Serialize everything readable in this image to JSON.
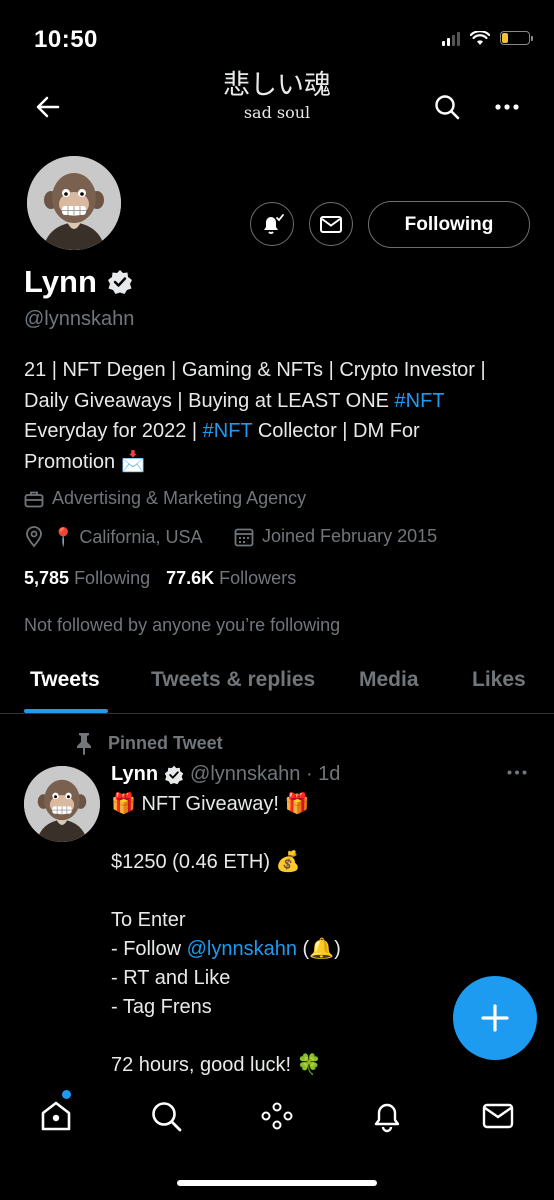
{
  "status_bar": {
    "time": "10:50"
  },
  "header": {
    "title": "悲しい魂",
    "subtitle": "sad soul"
  },
  "profile": {
    "name": "Lynn",
    "handle": "@lynnskahn",
    "follow_label": "Following",
    "bio": {
      "line1": "21 | NFT Degen | Gaming & NFTs | Crypto Investor |",
      "line2_a": "Daily Giveaways | Buying at LEAST ONE ",
      "line2_tag": "#NFT",
      "line3_a": "Everyday for 2022 | ",
      "line3_tag": "#NFT",
      "line3_b": " Collector | DM For",
      "line4": "Promotion 📩"
    },
    "category": "Advertising & Marketing Agency",
    "location": "📍 California, USA",
    "joined": "Joined February 2015",
    "following_count": "5,785",
    "following_label": "Following",
    "followers_count": "77.6K",
    "followers_label": "Followers",
    "not_followed": "Not followed by anyone you’re following"
  },
  "tabs": [
    {
      "label": "Tweets",
      "active": true
    },
    {
      "label": "Tweets & replies",
      "active": false
    },
    {
      "label": "Media",
      "active": false
    },
    {
      "label": "Likes",
      "active": false
    }
  ],
  "pinned_tweet": {
    "pinned_label": "Pinned Tweet",
    "author": "Lynn",
    "handle_time": "@lynnskahn · 1d",
    "lines": {
      "l1": "🎁 NFT Giveaway! 🎁",
      "l2": "$1250 (0.46 ETH) 💰",
      "l3": "To Enter",
      "l4_a": "- Follow ",
      "l4_mention": "@lynnskahn",
      "l4_b": " (🔔)",
      "l5": "- RT and Like",
      "l6": "- Tag Frens",
      "l7": "72 hours, good luck! 🍀"
    }
  },
  "colors": {
    "accent": "#1d9bf0",
    "background": "#000000",
    "muted": "#71767b",
    "battery": "#f2c230"
  },
  "icons": [
    "back-arrow-icon",
    "search-icon",
    "more-icon",
    "notification-bell-icon",
    "mail-icon",
    "verified-icon",
    "briefcase-icon",
    "location-icon",
    "calendar-icon",
    "pin-icon",
    "compose-plus-icon",
    "home-icon",
    "spaces-icon"
  ]
}
